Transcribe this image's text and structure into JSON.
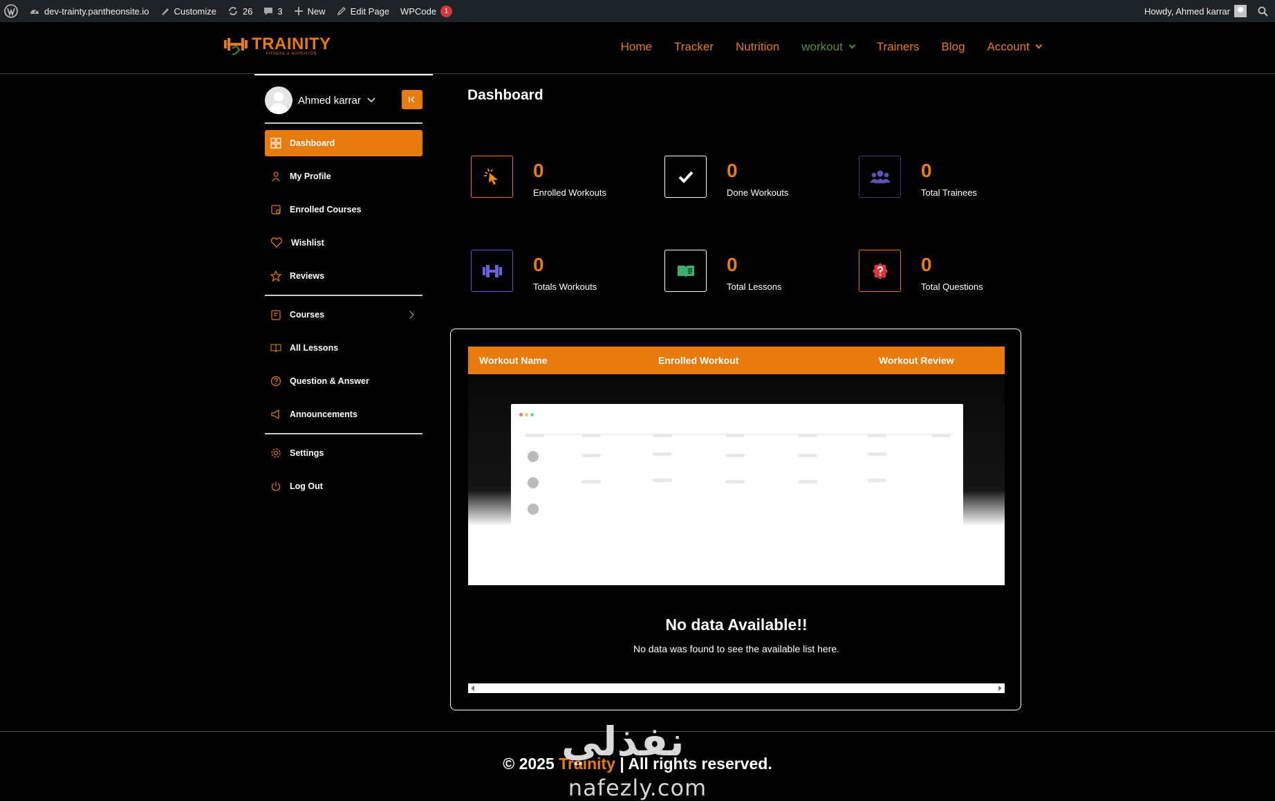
{
  "adminbar": {
    "site": "dev-trainty.pantheonsite.io",
    "customize": "Customize",
    "updates": "26",
    "comments": "3",
    "new": "New",
    "edit_page": "Edit Page",
    "wpcode": "WPCode",
    "wpcode_badge": "1",
    "howdy": "Howdy, Ahmed karrar"
  },
  "header": {
    "logo_text": "TRAINITY",
    "logo_sub": "FITNESS & NUTRITION",
    "nav": [
      {
        "label": "Home"
      },
      {
        "label": "Tracker"
      },
      {
        "label": "Nutrition"
      },
      {
        "label": "workout"
      },
      {
        "label": "Trainers"
      },
      {
        "label": "Blog"
      },
      {
        "label": "Account"
      }
    ]
  },
  "sidebar": {
    "user_name": "Ahmed karrar",
    "items": [
      {
        "label": "Dashboard",
        "icon": "grid-icon"
      },
      {
        "label": "My Profile",
        "icon": "user-icon"
      },
      {
        "label": "Enrolled Courses",
        "icon": "course-icon"
      },
      {
        "label": "Wishlist",
        "icon": "heart-icon"
      },
      {
        "label": "Reviews",
        "icon": "star-icon"
      },
      {
        "label": "Courses",
        "icon": "clipboard-icon"
      },
      {
        "label": "All Lessons",
        "icon": "book-icon"
      },
      {
        "label": "Question & Answer",
        "icon": "question-icon"
      },
      {
        "label": "Announcements",
        "icon": "megaphone-icon"
      },
      {
        "label": "Settings",
        "icon": "gear-icon"
      },
      {
        "label": "Log Out",
        "icon": "power-icon"
      }
    ]
  },
  "main": {
    "title": "Dashboard",
    "stats": [
      {
        "value": "0",
        "label": "Enrolled Workouts",
        "icon": "cursor-click-icon"
      },
      {
        "value": "0",
        "label": "Done Workouts",
        "icon": "check-icon"
      },
      {
        "value": "0",
        "label": "Total Trainees",
        "icon": "users-icon"
      },
      {
        "value": "0",
        "label": "Totals Workouts",
        "icon": "dumbbell-icon"
      },
      {
        "value": "0",
        "label": "Total Lessons",
        "icon": "book-open-icon"
      },
      {
        "value": "0",
        "label": "Total Questions",
        "icon": "question-badge-icon"
      }
    ],
    "table": {
      "columns": [
        "Workout Name",
        "Enrolled Workout",
        "Workout Review"
      ],
      "empty_title": "No data Available!!",
      "empty_sub": "No data was found to see the available list here."
    }
  },
  "footer": {
    "prefix": "© 2025 ",
    "brand": "Trainity",
    "suffix": " | All rights reserved."
  },
  "watermark": {
    "arabic": "نفذلي",
    "domain": "nafezly.com"
  },
  "colors": {
    "accent": "#e87b0c",
    "active_nav": "#5b8f2e",
    "background": "#000000",
    "adminbar": "#1d2327"
  }
}
